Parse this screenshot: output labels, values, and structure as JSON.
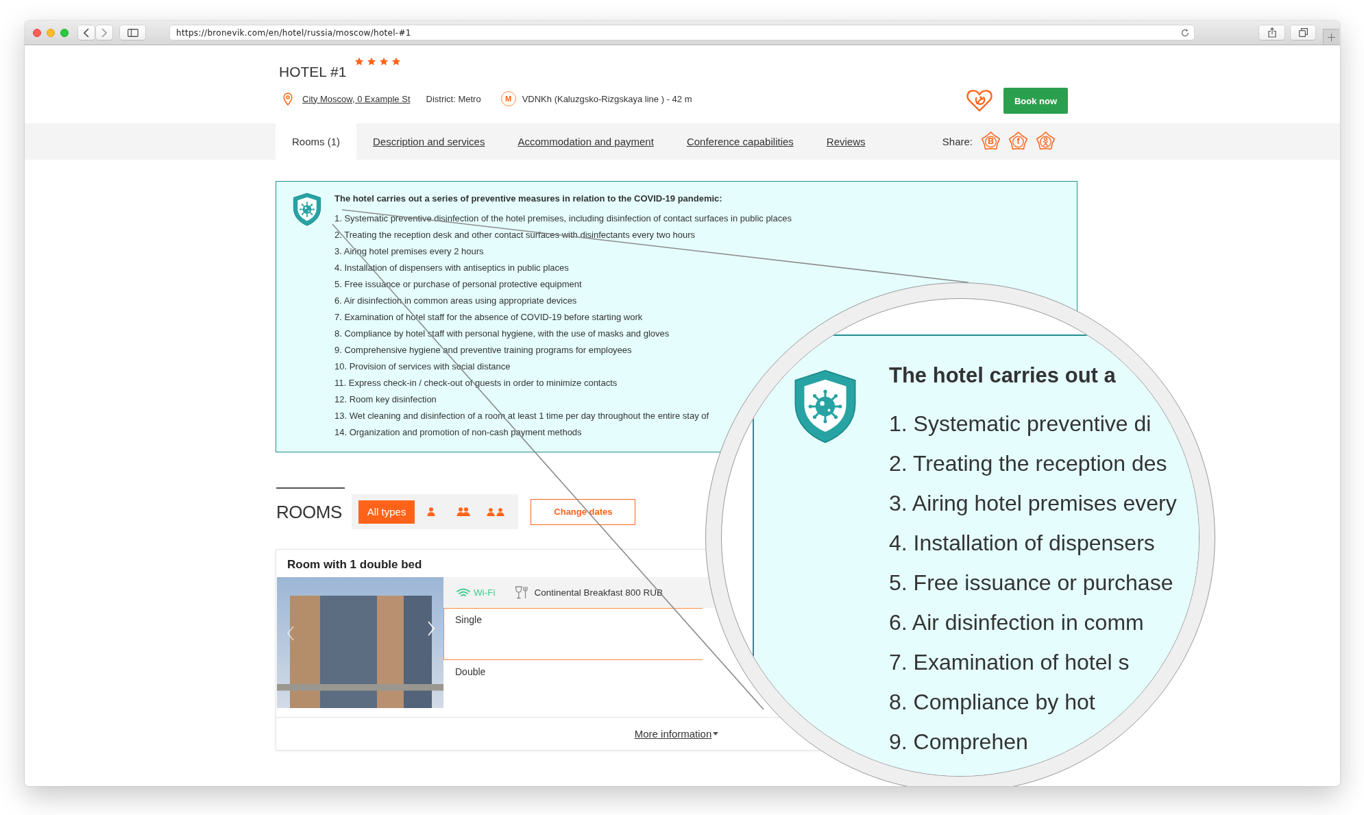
{
  "browser": {
    "url": "https://bronevik.com/en/hotel/russia/moscow/hotel-#1"
  },
  "hotel": {
    "name": "HOTEL #1",
    "stars": 4,
    "address": "City Moscow, 0 Example St",
    "district": "District: Metro",
    "metro": {
      "badge": "M",
      "station": "VDNKh (Kaluzgsko-Rizgskaya line ) - 42 m"
    },
    "book_button": "Book now"
  },
  "tabs": [
    {
      "label": "Rooms (1)",
      "selected": true
    },
    {
      "label": "Description and services",
      "selected": false
    },
    {
      "label": "Accommodation and payment",
      "selected": false
    },
    {
      "label": "Conference capabilities",
      "selected": false
    },
    {
      "label": "Reviews",
      "selected": false
    }
  ],
  "share": {
    "label": "Share:",
    "buttons": [
      {
        "kind": "letter",
        "text": "B"
      },
      {
        "kind": "letter",
        "text": "f"
      },
      {
        "kind": "figure"
      }
    ]
  },
  "covid_notice": {
    "title": "The hotel carries out a series of preventive measures in relation to the COVID-19 pandemic:",
    "items": [
      "1. Systematic preventive disinfection of the hotel premises, including disinfection of contact surfaces in public places",
      "2. Treating the reception desk and other contact surfaces with disinfectants every two hours",
      "3. Airing hotel premises every 2 hours",
      "4. Installation of dispensers with antiseptics in public places",
      "5. Free issuance or purchase of personal protective equipment",
      "6. Air disinfection in common areas using appropriate devices",
      "7. Examination of hotel staff for the absence of COVID-19 before starting work",
      "8. Compliance by hotel staff with personal hygiene, with the use of masks and gloves",
      "9. Comprehensive hygiene and preventive training programs for employees",
      "10. Provision of services with social distance",
      "11. Express check-in / check-out of guests in order to minimize contacts",
      "12. Room key disinfection",
      "13. Wet cleaning and disinfection of a room at least 1 time per day throughout the entire stay of",
      "14. Organization and promotion of non-cash payment methods"
    ]
  },
  "rooms": {
    "title": "ROOMS",
    "filters": [
      {
        "kind": "text",
        "label": "All types",
        "selected": true
      },
      {
        "kind": "one",
        "selected": false
      },
      {
        "kind": "two-close",
        "selected": false
      },
      {
        "kind": "two-apart",
        "selected": false
      }
    ],
    "change_dates": "Change dates",
    "cards": [
      {
        "title": "Room with 1 double bed",
        "amenities": [
          {
            "kind": "wifi",
            "label": "Wi-Fi"
          },
          {
            "kind": "meal",
            "label": "Continental Breakfast 800 RUB"
          }
        ],
        "rates": [
          {
            "label": "Single",
            "selected": true
          },
          {
            "label": "Double",
            "selected": false
          }
        ],
        "more_link": "More information"
      }
    ]
  },
  "magnifier": {
    "title": "The hotel carries out a",
    "items": [
      "1. Systematic preventive di",
      "2. Treating the reception des",
      "3. Airing hotel premises every",
      "4. Installation of dispensers",
      "5. Free issuance or purchase",
      "6. Air disinfection in comm",
      "7. Examination of hotel s",
      "8. Compliance by hot",
      "9. Comprehen"
    ]
  }
}
